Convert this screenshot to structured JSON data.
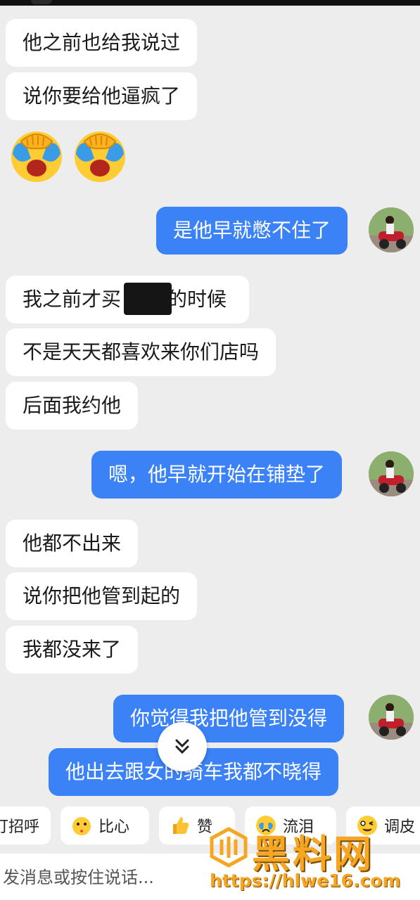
{
  "messages": [
    {
      "side": "left",
      "text": "他之前也给我说过"
    },
    {
      "side": "left",
      "text": "说你要给他逼疯了"
    },
    {
      "side": "left",
      "type": "emoji",
      "emoji_name": "facepalm-crying-icon",
      "count": 2
    },
    {
      "side": "right",
      "text": "是他早就憋不住了"
    },
    {
      "side": "left",
      "text": "我之前才买",
      "text_after": "的时候"
    },
    {
      "side": "left",
      "text": "不是天天都喜欢来你们店吗"
    },
    {
      "side": "left",
      "text": "后面我约他"
    },
    {
      "side": "right",
      "text": "嗯，他早就开始在铺垫了"
    },
    {
      "side": "left",
      "text": "他都不出来"
    },
    {
      "side": "left",
      "text": "说你把他管到起的"
    },
    {
      "side": "left",
      "text": "我都没来了"
    },
    {
      "side": "right",
      "text": "你觉得我把他管到没得"
    },
    {
      "side": "right",
      "text": "他出去跟女的骑车我都不晓得"
    }
  ],
  "quick_replies": [
    {
      "label": "打招呼",
      "icon": "none"
    },
    {
      "label": "比心",
      "icon": "heart-hands-icon"
    },
    {
      "label": "赞",
      "icon": "thumbs-up-icon"
    },
    {
      "label": "流泪",
      "icon": "crying-face-icon"
    },
    {
      "label": "调皮",
      "icon": "wink-face-icon"
    }
  ],
  "input": {
    "placeholder": "发消息或按住说话..."
  },
  "watermark": {
    "title": "黑料网",
    "url": "https://hlwe16.com"
  },
  "colors": {
    "background": "#ededed",
    "left_bubble": "#ffffff",
    "right_bubble": "#3b82f6",
    "watermark": "#f5a623"
  }
}
